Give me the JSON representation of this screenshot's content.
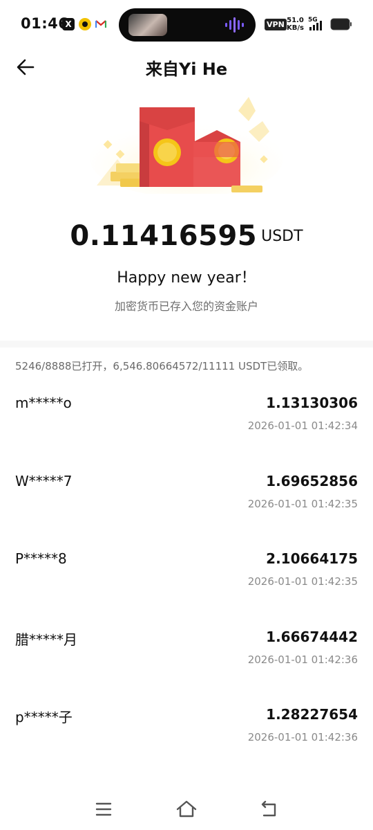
{
  "status_bar": {
    "time": "01:46",
    "x_icon": "x-icon",
    "vpn_label": "VPN",
    "net_speed_value": "51.0",
    "net_speed_unit": "KB/s",
    "network_type": "5G"
  },
  "header": {
    "back_icon": "arrow-left-icon",
    "title": "来自Yi He"
  },
  "packet": {
    "amount": "0.11416595",
    "unit": "USDT",
    "greeting": "Happy new year！",
    "deposit_note": "加密货币已存入您的资金账户"
  },
  "summary": "5246/8888已打开，6,546.80664572/11111 USDT已领取。",
  "records": [
    {
      "name": "m*****o",
      "amount": "1.13130306",
      "time": "2026-01-01 01:42:34"
    },
    {
      "name": "W*****7",
      "amount": "1.69652856",
      "time": "2026-01-01 01:42:35"
    },
    {
      "name": "P*****8",
      "amount": "2.10664175",
      "time": "2026-01-01 01:42:35"
    },
    {
      "name": "腊*****月",
      "amount": "1.66674442",
      "time": "2026-01-01 01:42:36"
    },
    {
      "name": "p*****子",
      "amount": "1.28227654",
      "time": "2026-01-01 01:42:36"
    }
  ],
  "navbar": {
    "menu_icon": "menu-icon",
    "home_icon": "home-icon",
    "back_icon": "back-icon"
  },
  "colors": {
    "envelope_red": "#e74c4c",
    "envelope_dark": "#c93c3e",
    "coin_gold": "#f5c518",
    "sparkle_yellow": "#fde9a8",
    "text_primary": "#111111",
    "text_secondary": "#6e6e6e"
  }
}
